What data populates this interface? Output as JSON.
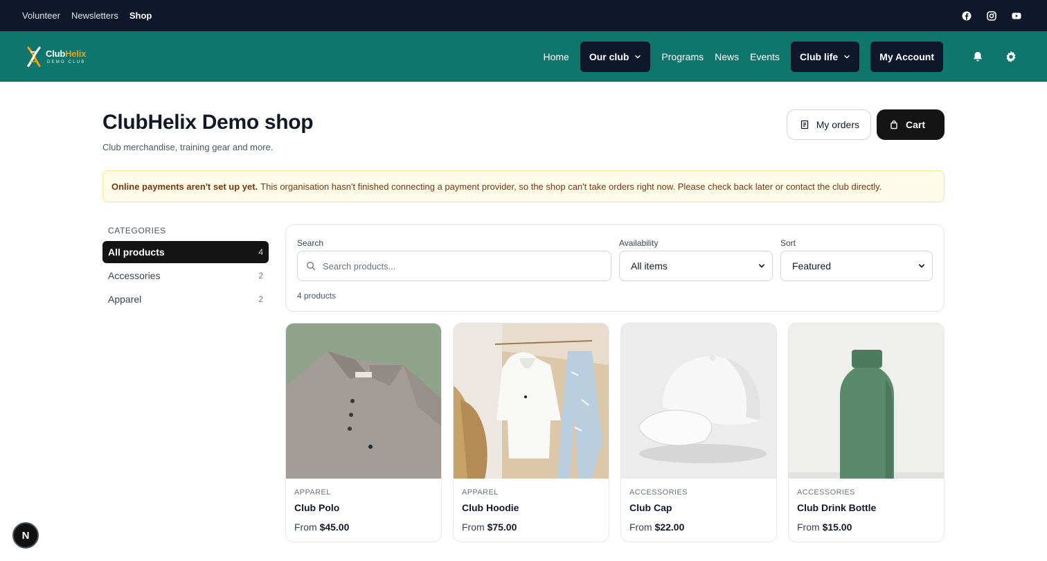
{
  "topbar": {
    "links": [
      {
        "label": "Volunteer"
      },
      {
        "label": "Newsletters"
      },
      {
        "label": "Shop"
      }
    ],
    "social_icons": [
      "facebook-icon",
      "instagram-icon",
      "youtube-icon"
    ]
  },
  "nav": {
    "logo_name_part1": "Club",
    "logo_name_part2": "Helix",
    "logo_sub": "DEMO CLUB",
    "items": {
      "home": "Home",
      "our_club": "Our club",
      "programs": "Programs",
      "news": "News",
      "events": "Events",
      "club_life": "Club life",
      "my_account": "My Account"
    },
    "icons": [
      "bell-icon",
      "gear-icon"
    ]
  },
  "header": {
    "title": "ClubHelix Demo shop",
    "subtitle": "Club merchandise, training gear and more.",
    "my_orders_label": "My orders",
    "cart_label": "Cart"
  },
  "alert": {
    "bold": "Online payments aren't set up yet.",
    "text": "This organisation hasn't finished connecting a payment provider, so the shop can't take orders right now. Please check back later or contact the club directly."
  },
  "categories": {
    "label": "CATEGORIES",
    "items": [
      {
        "label": "All products",
        "count": "4"
      },
      {
        "label": "Accessories",
        "count": "2"
      },
      {
        "label": "Apparel",
        "count": "2"
      }
    ]
  },
  "filters": {
    "search_label": "Search",
    "search_value": "",
    "search_placeholder": "Search products...",
    "availability_label": "Availability",
    "availability_value": "All items",
    "sort_label": "Sort",
    "sort_value": "Featured",
    "count_text": "4 products"
  },
  "products": [
    {
      "category": "APPAREL",
      "name": "Club Polo",
      "price_prefix": "From",
      "price": "$45.00"
    },
    {
      "category": "APPAREL",
      "name": "Club Hoodie",
      "price_prefix": "From",
      "price": "$75.00"
    },
    {
      "category": "ACCESSORIES",
      "name": "Club Cap",
      "price_prefix": "From",
      "price": "$22.00"
    },
    {
      "category": "ACCESSORIES",
      "name": "Club Drink Bottle",
      "price_prefix": "From",
      "price": "$15.00"
    }
  ],
  "badge": {
    "label": "N"
  },
  "colors": {
    "topbar_bg": "#0f172a",
    "nav_bg": "#0f766e",
    "dark_button": "#141414",
    "logo_accent": "#f59e0b",
    "alert_bg": "#fefce8",
    "alert_border": "#fde68a",
    "alert_text": "#78350f"
  }
}
